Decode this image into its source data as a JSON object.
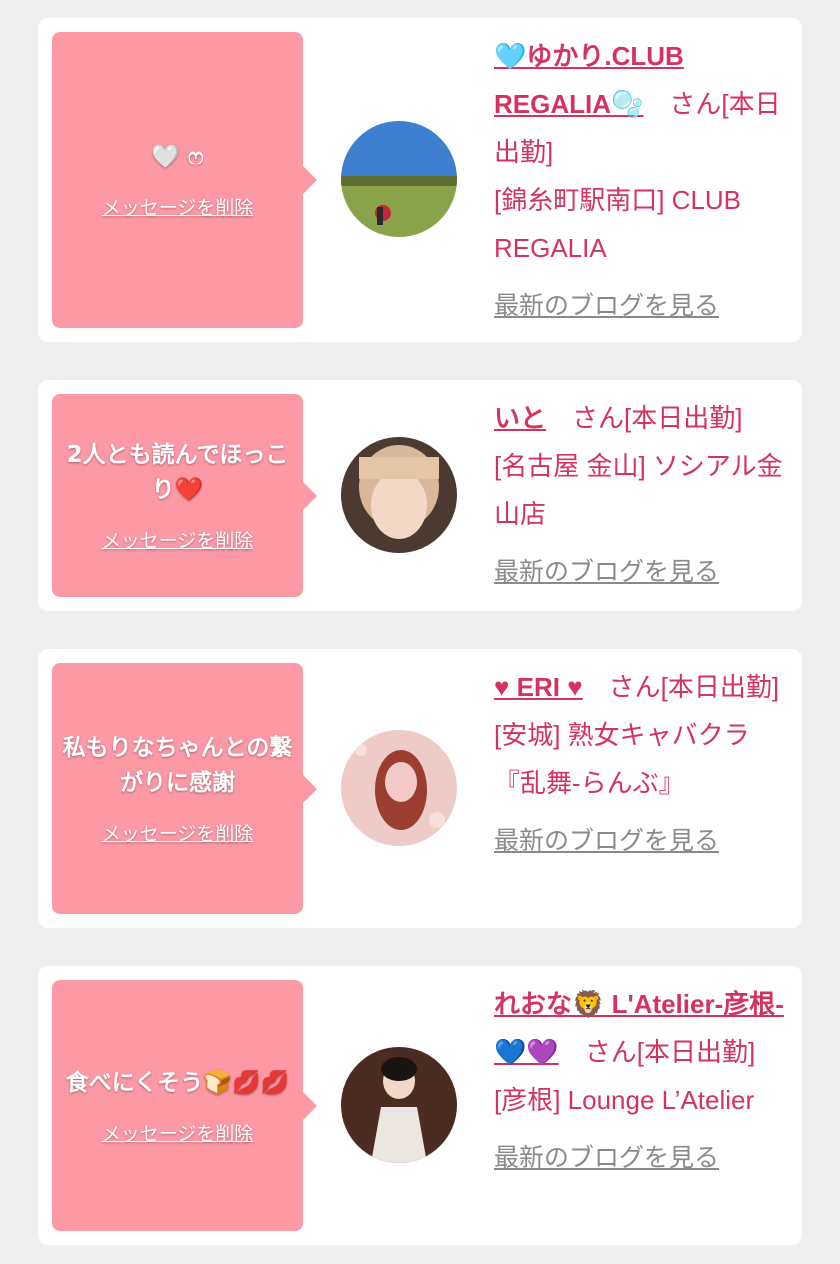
{
  "delete_label": "メッセージを削除",
  "blog_label": "最新のブログを見る",
  "colors": {
    "page_bg": "#efefef",
    "card_bg": "#ffffff",
    "bubble": "#fd98a5",
    "accent": "#d4335f",
    "link_gray": "#8a8a8a"
  },
  "items": [
    {
      "message": "🤍 ෆ",
      "name": "🩵ゆかり.CLUB REGALIA🫧",
      "suffix": "さん[本日出勤]",
      "shop": "[錦糸町駅南口] CLUB REGALIA",
      "avatar_icon": "avatar-park-photo"
    },
    {
      "message": "2人とも読んでほっこり❤️",
      "name": "いと",
      "suffix": "さん[本日出勤]",
      "shop": "[名古屋 金山] ソシアル金山店",
      "avatar_icon": "avatar-girl-photo"
    },
    {
      "message": "私もりなちゃんとの繋がりに感謝",
      "name": "♥ ERI ♥",
      "suffix": "さん[本日出勤]",
      "shop": "[安城] 熟女キャバクラ『乱舞-らんぶ』",
      "avatar_icon": "avatar-woman-photo"
    },
    {
      "message": "食べにくそう🍞💋💋",
      "name": "れおな🦁 L'Atelier-彦根-💙💜",
      "suffix": "さん[本日出勤]",
      "shop": "[彦根] Lounge L’Atelier",
      "avatar_icon": "avatar-dress-photo"
    }
  ]
}
